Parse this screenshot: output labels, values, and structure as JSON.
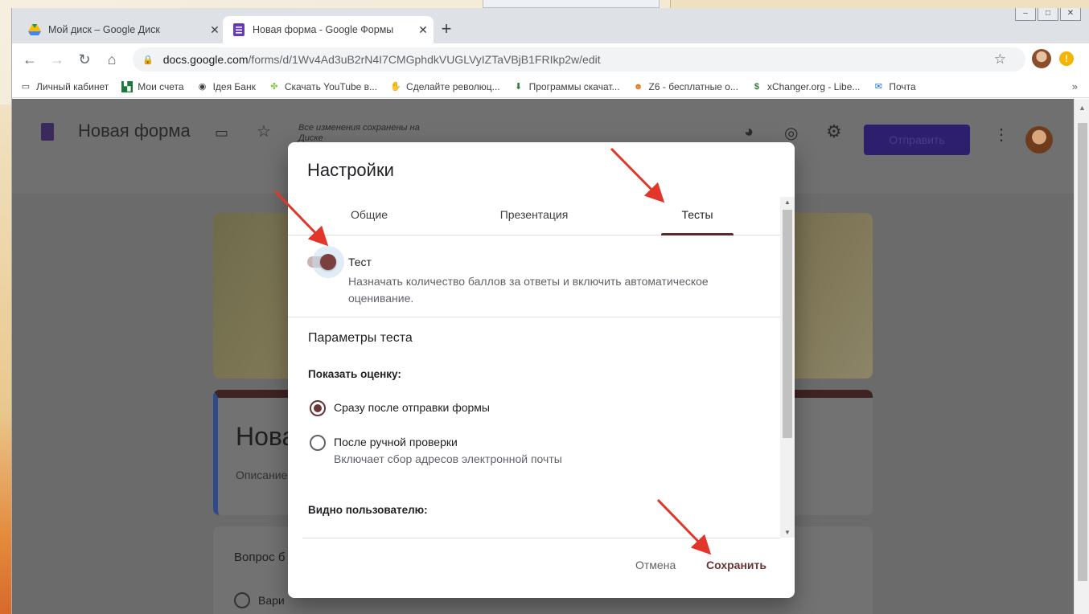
{
  "browser": {
    "tabs": [
      {
        "title": "Мой диск – Google Диск",
        "icon": "google-drive-icon"
      },
      {
        "title": "Новая форма - Google Формы",
        "icon": "google-forms-icon"
      }
    ],
    "url_host": "docs.google.com",
    "url_path": "/forms/d/1Wv4Ad3uB2rN4I7CMGphdkVUGLVyIZTaVBjB1FRIkp2w/edit",
    "bookmarks": [
      {
        "label": "Личный кабинет",
        "icon": "page-icon"
      },
      {
        "label": "Мои счета",
        "icon": "bank-icon"
      },
      {
        "label": "Ідея Банк",
        "icon": "globe-icon"
      },
      {
        "label": "Скачать YouTube в...",
        "icon": "leaf-icon"
      },
      {
        "label": "Сделайте революц...",
        "icon": "hand-icon"
      },
      {
        "label": "Программы скачат...",
        "icon": "download-icon"
      },
      {
        "label": "Z6 - бесплатные о...",
        "icon": "face-icon"
      },
      {
        "label": "xChanger.org - Libe...",
        "icon": "dollar-icon"
      },
      {
        "label": "Почта",
        "icon": "mail-icon"
      }
    ]
  },
  "app": {
    "title": "Новая форма",
    "saved_status": "Все изменения сохранены на Диске",
    "send_label": "Отправить",
    "form_title_partial": "Нова",
    "form_desc_partial": "Описание",
    "question_partial": "Вопрос б",
    "option_partial": "Вари"
  },
  "dialog": {
    "title": "Настройки",
    "tabs": [
      "Общие",
      "Презентация",
      "Тесты"
    ],
    "quiz_label": "Тест",
    "quiz_desc": "Назначать количество баллов за ответы и включить автоматическое оценивание.",
    "params_title": "Параметры теста",
    "show_grade_title": "Показать оценку:",
    "option_immediate": "Сразу после отправки формы",
    "option_manual": "После ручной проверки",
    "option_manual_desc": "Включает сбор адресов электронной почты",
    "visible_title": "Видно пользователю:",
    "cancel_label": "Отмена",
    "save_label": "Сохранить"
  },
  "colors": {
    "accent": "#6a3535",
    "arrow": "#e2362a"
  }
}
